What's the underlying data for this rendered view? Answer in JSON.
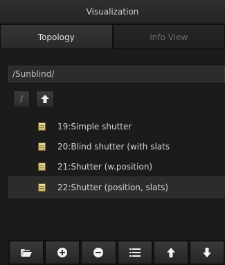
{
  "window": {
    "title": "Visualization"
  },
  "tabs": [
    {
      "label": "Topology",
      "active": true
    },
    {
      "label": "Info View",
      "active": false
    }
  ],
  "path": {
    "value": "/Sunblind/"
  },
  "nav": {
    "root_label": "/",
    "up_icon": "arrow-up-icon"
  },
  "list": {
    "items": [
      {
        "label": "19:Simple shutter",
        "icon": "document-icon",
        "selected": false
      },
      {
        "label": "20:Blind shutter (with slats",
        "icon": "document-icon",
        "selected": false
      },
      {
        "label": "21:Shutter (w.position)",
        "icon": "document-icon",
        "selected": false
      },
      {
        "label": "22:Shutter (position, slats)",
        "icon": "document-icon",
        "selected": true
      }
    ]
  },
  "toolbar": {
    "buttons": [
      {
        "icon": "folder-open-icon"
      },
      {
        "icon": "plus-circle-icon"
      },
      {
        "icon": "minus-circle-icon"
      },
      {
        "icon": "list-icon"
      },
      {
        "icon": "arrow-up-icon"
      },
      {
        "icon": "arrow-down-icon"
      }
    ]
  },
  "colors": {
    "background": "#1b1b1b",
    "text": "#d2d2d2",
    "inactive_text": "#6b6b6b",
    "icon_yellow": "#e0cf86"
  }
}
